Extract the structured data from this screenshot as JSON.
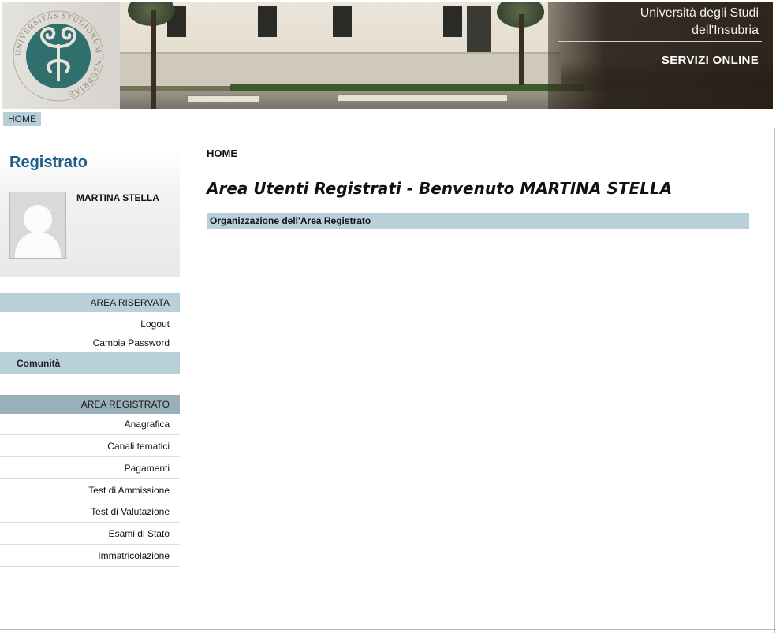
{
  "header": {
    "university_line1": "Università degli Studi",
    "university_line2": "dell'Insubria",
    "services_label": "SERVIZI ONLINE",
    "logo_icon": "university-seal-icon",
    "logo_seal_text": "UNIVERSITAS STUDIORUM INSUBRIAE"
  },
  "topnav": {
    "home_label": "HOME"
  },
  "sidebar": {
    "title": "Registrato",
    "user_name": "MARTINA STELLA",
    "avatar_icon": "user-avatar-icon",
    "area_riservata": {
      "heading": "AREA RISERVATA",
      "items": [
        {
          "label": "Logout"
        },
        {
          "label": "Cambia Password"
        }
      ]
    },
    "comunita_label": "Comunità",
    "area_registrato": {
      "heading": "AREA REGISTRATO",
      "items": [
        {
          "label": "Anagrafica"
        },
        {
          "label": "Canali tematici"
        },
        {
          "label": "Pagamenti"
        },
        {
          "label": "Test di Ammissione"
        },
        {
          "label": "Test di Valutazione"
        },
        {
          "label": "Esami di Stato"
        },
        {
          "label": "Immatricolazione"
        }
      ]
    }
  },
  "main": {
    "breadcrumb": "HOME",
    "title": "Area Utenti Registrati - Benvenuto MARTINA STELLA",
    "section_heading": "Organizzazione dell'Area Registrato"
  },
  "colors": {
    "accent_blue": "#1d5d88",
    "light_bar": "#b9cfda",
    "dark_bar": "#99b0bb"
  }
}
